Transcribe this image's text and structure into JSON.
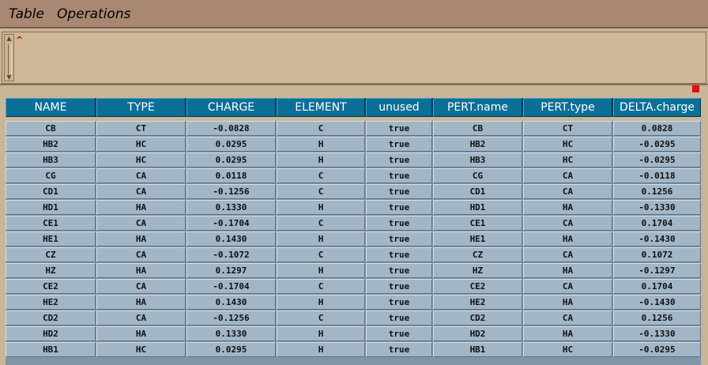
{
  "menu": {
    "table_label": "Table",
    "operations_label": "Operations"
  },
  "editor": {
    "caret_glyph": "^"
  },
  "table": {
    "columns": [
      "NAME",
      "TYPE",
      "CHARGE",
      "ELEMENT",
      "unused",
      "PERT.name",
      "PERT.type",
      "DELTA.charge"
    ],
    "rows": [
      [
        "CB",
        "CT",
        "-0.0828",
        "C",
        "true",
        "CB",
        "CT",
        "0.0828"
      ],
      [
        "HB2",
        "HC",
        "0.0295",
        "H",
        "true",
        "HB2",
        "HC",
        "-0.0295"
      ],
      [
        "HB3",
        "HC",
        "0.0295",
        "H",
        "true",
        "HB3",
        "HC",
        "-0.0295"
      ],
      [
        "CG",
        "CA",
        "0.0118",
        "C",
        "true",
        "CG",
        "CA",
        "-0.0118"
      ],
      [
        "CD1",
        "CA",
        "-0.1256",
        "C",
        "true",
        "CD1",
        "CA",
        "0.1256"
      ],
      [
        "HD1",
        "HA",
        "0.1330",
        "H",
        "true",
        "HD1",
        "HA",
        "-0.1330"
      ],
      [
        "CE1",
        "CA",
        "-0.1704",
        "C",
        "true",
        "CE1",
        "CA",
        "0.1704"
      ],
      [
        "HE1",
        "HA",
        "0.1430",
        "H",
        "true",
        "HE1",
        "HA",
        "-0.1430"
      ],
      [
        "CZ",
        "CA",
        "-0.1072",
        "C",
        "true",
        "CZ",
        "CA",
        "0.1072"
      ],
      [
        "HZ",
        "HA",
        "0.1297",
        "H",
        "true",
        "HZ",
        "HA",
        "-0.1297"
      ],
      [
        "CE2",
        "CA",
        "-0.1704",
        "C",
        "true",
        "CE2",
        "CA",
        "0.1704"
      ],
      [
        "HE2",
        "HA",
        "0.1430",
        "H",
        "true",
        "HE2",
        "HA",
        "-0.1430"
      ],
      [
        "CD2",
        "CA",
        "-0.1256",
        "C",
        "true",
        "CD2",
        "CA",
        "0.1256"
      ],
      [
        "HD2",
        "HA",
        "0.1330",
        "H",
        "true",
        "HD2",
        "HA",
        "-0.1330"
      ],
      [
        "HB1",
        "HC",
        "0.0295",
        "H",
        "true",
        "HB1",
        "HC",
        "-0.0295"
      ]
    ]
  },
  "colors": {
    "menubar": "#a88872",
    "header": "#0c6f96",
    "cell": "#a2b6c6",
    "indicator": "#e01010"
  }
}
